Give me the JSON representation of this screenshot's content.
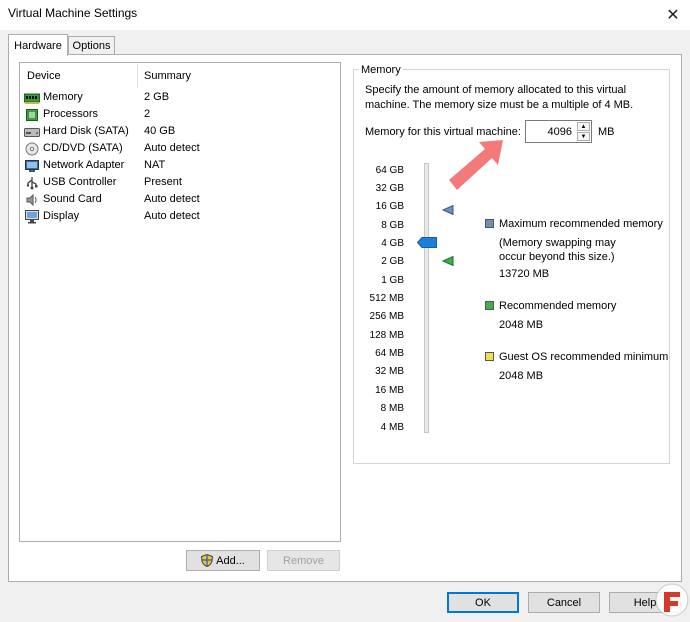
{
  "window": {
    "title": "Virtual Machine Settings",
    "close_glyph": "✕"
  },
  "tabs": [
    {
      "label": "Hardware",
      "active": true
    },
    {
      "label": "Options",
      "active": false
    }
  ],
  "device_list": {
    "columns": [
      "Device",
      "Summary"
    ],
    "rows": [
      {
        "device": "Memory",
        "summary": "2 GB",
        "icon": "memory-icon"
      },
      {
        "device": "Processors",
        "summary": "2",
        "icon": "processor-icon"
      },
      {
        "device": "Hard Disk (SATA)",
        "summary": "40 GB",
        "icon": "hard-disk-icon"
      },
      {
        "device": "CD/DVD (SATA)",
        "summary": "Auto detect",
        "icon": "cd-dvd-icon"
      },
      {
        "device": "Network Adapter",
        "summary": "NAT",
        "icon": "network-adapter-icon"
      },
      {
        "device": "USB Controller",
        "summary": "Present",
        "icon": "usb-icon"
      },
      {
        "device": "Sound Card",
        "summary": "Auto detect",
        "icon": "sound-card-icon"
      },
      {
        "device": "Display",
        "summary": "Auto detect",
        "icon": "display-icon"
      }
    ]
  },
  "list_buttons": {
    "add": "Add...",
    "remove": "Remove"
  },
  "memory": {
    "group_label": "Memory",
    "description": "Specify the amount of memory allocated to this virtual machine. The memory size must be a multiple of 4 MB.",
    "field_label": "Memory for this virtual machine:",
    "value": "4096",
    "unit": "MB",
    "slider_ticks": [
      "64 GB",
      "32 GB",
      "16 GB",
      "8 GB",
      "4 GB",
      "2 GB",
      "1 GB",
      "512 MB",
      "256 MB",
      "128 MB",
      "64 MB",
      "32 MB",
      "16 MB",
      "8 MB",
      "4 MB"
    ],
    "slider_selected": "4 GB",
    "legend": {
      "max_title": "Maximum recommended memory",
      "max_note": "(Memory swapping may occur beyond this size.)",
      "max_value": "13720 MB",
      "rec_title": "Recommended memory",
      "rec_value": "2048 MB",
      "min_title": "Guest OS recommended minimum",
      "min_value": "2048 MB"
    }
  },
  "colors": {
    "max_marker": "#6f8fb5",
    "recommended_marker": "#3cb04a",
    "minimum_marker": "#f0e04a",
    "slider_thumb": "#1e7fd8",
    "annotation_arrow": "#f47a7a"
  },
  "dialog_buttons": {
    "ok": "OK",
    "cancel": "Cancel",
    "help": "Help"
  }
}
